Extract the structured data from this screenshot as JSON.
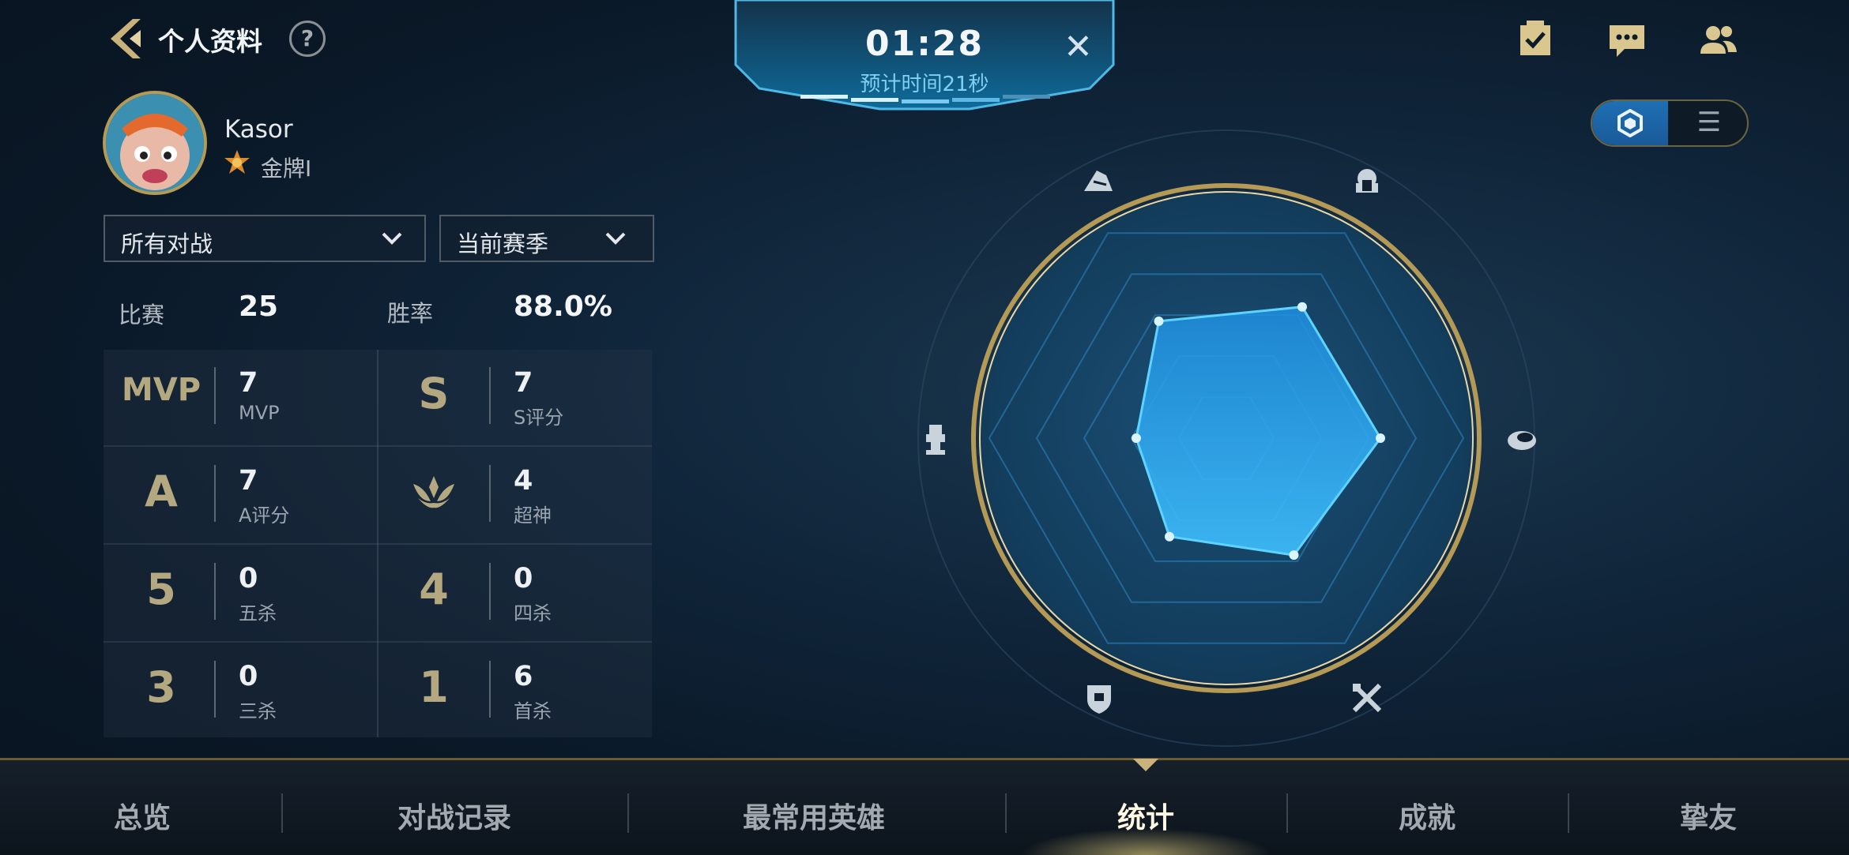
{
  "header": {
    "title": "个人资料",
    "help_label": "?"
  },
  "timer": {
    "time": "01:28",
    "estimate": "预计时间21秒",
    "close_label": "✕"
  },
  "top_icons": [
    "task-icon",
    "chat-icon",
    "friends-icon"
  ],
  "view_toggle": {
    "active": "radar",
    "list_label": "☰"
  },
  "profile": {
    "name": "Kasor",
    "rank": "金牌I"
  },
  "filters": {
    "mode": "所有对战",
    "season": "当前赛季"
  },
  "summary": {
    "matches_label": "比赛",
    "matches_value": "25",
    "winrate_label": "胜率",
    "winrate_value": "88.0%"
  },
  "stats": [
    {
      "glyph": "MVP",
      "value": "7",
      "label": "MVP"
    },
    {
      "glyph": "S",
      "value": "7",
      "label": "S评分"
    },
    {
      "glyph": "A",
      "value": "7",
      "label": "A评分"
    },
    {
      "glyph": "wings",
      "value": "4",
      "label": "超神"
    },
    {
      "glyph": "5",
      "value": "0",
      "label": "五杀"
    },
    {
      "glyph": "4",
      "value": "0",
      "label": "四杀"
    },
    {
      "glyph": "3",
      "value": "0",
      "label": "三杀"
    },
    {
      "glyph": "1",
      "value": "6",
      "label": "首杀"
    }
  ],
  "radar": {
    "axes": [
      "assassin-icon",
      "warrior-icon",
      "mage-icon",
      "marksman-icon",
      "tank-icon",
      "support-icon"
    ],
    "values": [
      0.57,
      0.64,
      0.65,
      0.57,
      0.48,
      0.38
    ]
  },
  "colors": {
    "accent": "#1e8fe0",
    "gold": "#b49a55"
  },
  "nav": {
    "items": [
      "总览",
      "对战记录",
      "最常用英雄",
      "统计",
      "成就",
      "挚友"
    ],
    "active": "统计"
  }
}
